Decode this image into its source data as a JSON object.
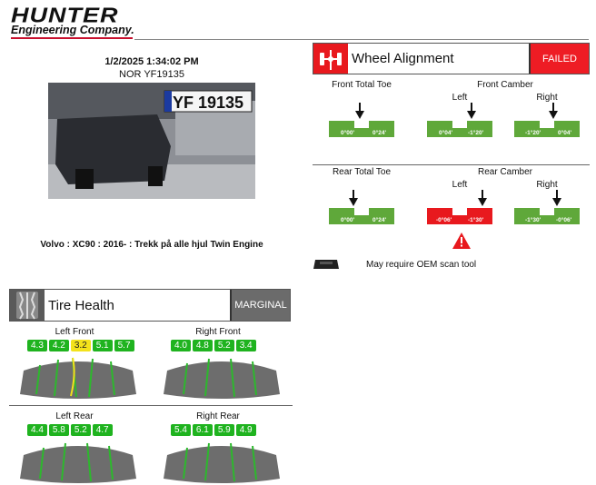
{
  "logo": {
    "main": "HUNTER",
    "sub": "Engineering Company."
  },
  "report": {
    "datetime": "1/2/2025 1:34:02 PM",
    "plate": "NOR YF19135",
    "photo_plate": "YF 19135",
    "vehicle": "Volvo : XC90 : 2016- : Trekk på alle hjul Twin Engine"
  },
  "alignment": {
    "title": "Wheel Alignment",
    "status": "FAILED",
    "front_toe": {
      "label": "Front Total Toe",
      "min": "0°00'",
      "max": "0°24'"
    },
    "front_camber": {
      "label": "Front Camber",
      "left": {
        "label": "Left",
        "min": "0°04'",
        "max": "-1°20'"
      },
      "right": {
        "label": "Right",
        "min": "-1°20'",
        "max": "0°04'"
      }
    },
    "rear_toe": {
      "label": "Rear Total Toe",
      "min": "0°00'",
      "max": "0°24'"
    },
    "rear_camber": {
      "label": "Rear Camber",
      "left": {
        "label": "Left",
        "min": "-0°06'",
        "max": "-1°30'"
      },
      "right": {
        "label": "Right",
        "min": "-1°30'",
        "max": "-0°06'"
      }
    },
    "oem_note": "May require OEM scan tool"
  },
  "tires": {
    "title": "Tire Health",
    "status": "MARGINAL",
    "left_front": {
      "label": "Left Front",
      "depths": [
        "4.3",
        "4.2",
        "3.2",
        "5.1",
        "5.7"
      ],
      "warn_index": 2
    },
    "right_front": {
      "label": "Right Front",
      "depths": [
        "4.0",
        "4.8",
        "5.2",
        "3.4"
      ]
    },
    "left_rear": {
      "label": "Left Rear",
      "depths": [
        "4.4",
        "5.8",
        "5.2",
        "4.7"
      ]
    },
    "right_rear": {
      "label": "Right Rear",
      "depths": [
        "5.4",
        "6.1",
        "5.9",
        "4.9"
      ]
    }
  },
  "colors": {
    "failed": "#ee1c24",
    "gauge_ok": "#5fa83a",
    "gauge_fail": "#e8191e",
    "pill_ok": "#1fb31f",
    "pill_warn": "#f3e21b",
    "header_status": "#6b6b6b"
  }
}
